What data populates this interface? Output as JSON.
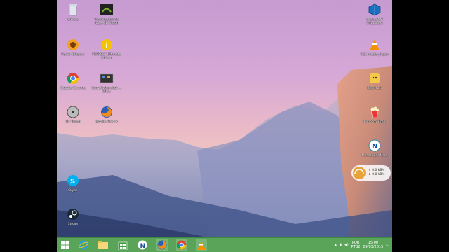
{
  "desktop": {
    "icons_left": [
      {
        "label": "Lixeira",
        "icon": "recycle-bin-icon"
      },
      {
        "label": "Visualizador de fotos 3D Vision",
        "icon": "nvidia-3d-vision-icon"
      },
      {
        "label": "Folder Cleaner",
        "icon": "folder-cleaner-icon"
      },
      {
        "label": "PERFECT Ultimate Edition",
        "icon": "perfect-info-icon"
      },
      {
        "label": "Google Chrome",
        "icon": "chrome-icon"
      },
      {
        "label": "Sony Cyber-shot ... 2011",
        "icon": "cyber-shot-icon"
      },
      {
        "label": "HD Tuned",
        "icon": "hd-tune-icon"
      },
      {
        "label": "Mozilla Firefox",
        "icon": "firefox-icon"
      },
      {
        "label": "Skype",
        "icon": "skype-icon"
      },
      {
        "label": "Steam",
        "icon": "steam-icon"
      }
    ],
    "icons_right": [
      {
        "label": "Oracle VM VirtualBox",
        "icon": "virtualbox-icon"
      },
      {
        "label": "VLC media player",
        "icon": "vlc-icon"
      },
      {
        "label": "BearHost",
        "icon": "bear-host-icon"
      },
      {
        "label": "Popcorn Time",
        "icon": "popcorn-time-icon"
      },
      {
        "label": "Messenger Nero",
        "icon": "nero-icon"
      }
    ]
  },
  "netwidget": {
    "up": "0.0 kB/s",
    "down": "0.0 kB/s"
  },
  "taskbar": {
    "items": [
      "windows-start-icon",
      "ie-icon",
      "file-explorer-icon",
      "store-icon",
      "nero-taskbar-icon",
      "firefox-taskbar-icon",
      "chrome-taskbar-icon",
      "vlc-taskbar-icon"
    ],
    "tray": {
      "lang": "POR",
      "layout": "PTB2",
      "time": "15:00",
      "date": "09/03/2015"
    }
  }
}
